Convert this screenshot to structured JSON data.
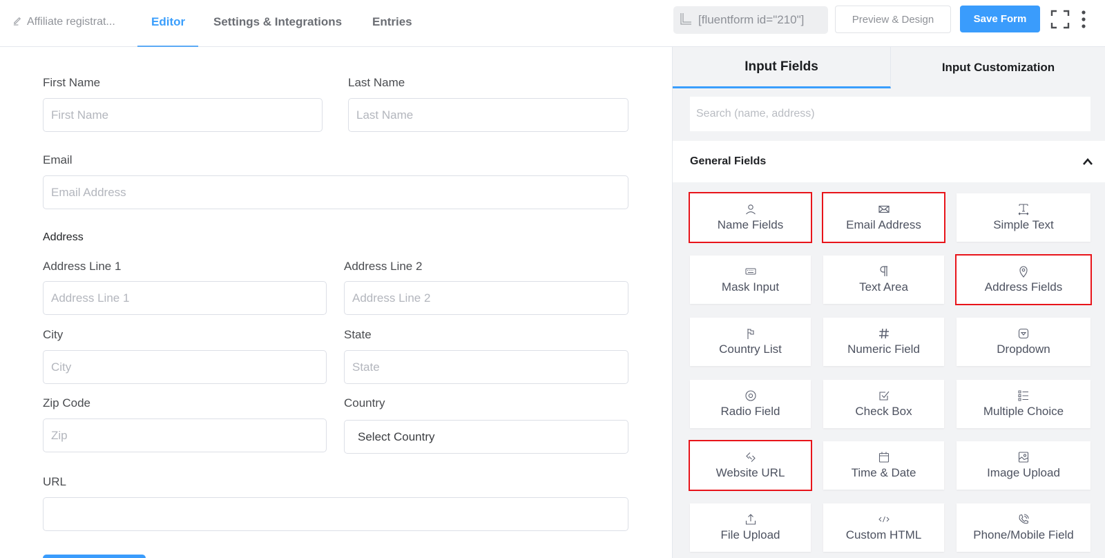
{
  "header": {
    "form_title": "Affiliate registrat...",
    "tabs": [
      {
        "label": "Editor",
        "active": true
      },
      {
        "label": "Settings & Integrations",
        "active": false
      },
      {
        "label": "Entries",
        "active": false
      }
    ],
    "shortcode": "[fluentform id=\"210\"]",
    "preview_label": "Preview & Design",
    "save_label": "Save Form"
  },
  "form": {
    "first_name": {
      "label": "First Name",
      "placeholder": "First Name"
    },
    "last_name": {
      "label": "Last Name",
      "placeholder": "Last Name"
    },
    "email": {
      "label": "Email",
      "placeholder": "Email Address"
    },
    "address_section": "Address",
    "address_line1": {
      "label": "Address Line 1",
      "placeholder": "Address Line 1"
    },
    "address_line2": {
      "label": "Address Line 2",
      "placeholder": "Address Line 2"
    },
    "city": {
      "label": "City",
      "placeholder": "City"
    },
    "state": {
      "label": "State",
      "placeholder": "State"
    },
    "zip": {
      "label": "Zip Code",
      "placeholder": "Zip"
    },
    "country": {
      "label": "Country",
      "value": "Select Country"
    },
    "url": {
      "label": "URL",
      "placeholder": ""
    }
  },
  "panel": {
    "tabs": [
      {
        "label": "Input Fields",
        "active": true
      },
      {
        "label": "Input Customization",
        "active": false
      }
    ],
    "search_placeholder": "Search (name, address)",
    "group_title": "General Fields",
    "highlight_color": "#e8141a",
    "fields": [
      {
        "label": "Name Fields",
        "icon": "user-icon",
        "highlighted": true
      },
      {
        "label": "Email Address",
        "icon": "envelope-icon",
        "highlighted": true
      },
      {
        "label": "Simple Text",
        "icon": "text-cursor-icon",
        "highlighted": false
      },
      {
        "label": "Mask Input",
        "icon": "keyboard-icon",
        "highlighted": false
      },
      {
        "label": "Text Area",
        "icon": "paragraph-icon",
        "highlighted": false
      },
      {
        "label": "Address Fields",
        "icon": "map-pin-icon",
        "highlighted": true
      },
      {
        "label": "Country List",
        "icon": "flag-icon",
        "highlighted": false
      },
      {
        "label": "Numeric Field",
        "icon": "hash-icon",
        "highlighted": false
      },
      {
        "label": "Dropdown",
        "icon": "dropdown-icon",
        "highlighted": false
      },
      {
        "label": "Radio Field",
        "icon": "radio-icon",
        "highlighted": false
      },
      {
        "label": "Check Box",
        "icon": "checkbox-icon",
        "highlighted": false
      },
      {
        "label": "Multiple Choice",
        "icon": "list-icon",
        "highlighted": false
      },
      {
        "label": "Website URL",
        "icon": "link-icon",
        "highlighted": true
      },
      {
        "label": "Time & Date",
        "icon": "calendar-icon",
        "highlighted": false
      },
      {
        "label": "Image Upload",
        "icon": "image-icon",
        "highlighted": false
      },
      {
        "label": "File Upload",
        "icon": "upload-icon",
        "highlighted": false
      },
      {
        "label": "Custom HTML",
        "icon": "code-icon",
        "highlighted": false
      },
      {
        "label": "Phone/Mobile Field",
        "icon": "phone-icon",
        "highlighted": false
      }
    ]
  }
}
